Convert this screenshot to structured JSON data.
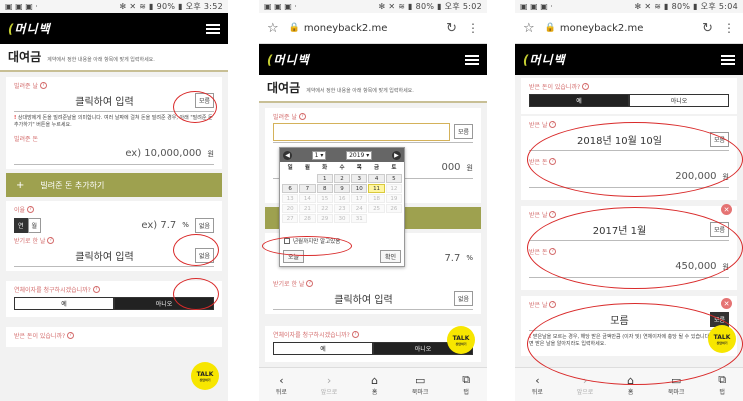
{
  "status": {
    "s1_left": "▣ ▣ ▣ ·",
    "s1_right": "✻ ✕ ≋ ▮ 90% ▮ 오후 3:52",
    "s2_left": "▣ ▣ ▣ ·",
    "s2_right": "✻ ✕ ≋ ▮ 80% ▮ 오후 5:02",
    "s3_left": "▣ ▣ ▣ ·",
    "s3_right": "✻ ✕ ≋ ▮ 80% ▮ 오후 5:04"
  },
  "url": "moneyback2.me",
  "logo": {
    "pre": "(",
    "main": "머니백"
  },
  "title": {
    "main": "대여금",
    "sub": "계약에서 정한 내용을 아래 항목에 맞게 입력하세요."
  },
  "p1": {
    "lend_date_label": "빌려준 날",
    "click_input": "클릭하여 입력",
    "mb": "모름",
    "warn": "상대방에게 돈을 빌려준날을 의미합니다. 여러 날짜에 걸쳐 돈을 빌려준 경우, 아래 \"빌려준 돈 추가하기\" 버튼을 누르세요.",
    "lend_amt_label": "빌려준 돈",
    "amt_ph": "ex) 10,000,000",
    "unit": "원",
    "add_btn": "빌려준 돈 추가하기",
    "add_plus": "+",
    "rate_label": "이율",
    "seg_a": "연",
    "seg_b": "월",
    "rate_ph": "ex) 7.7",
    "pct": "%",
    "mb2": "없음",
    "ret_label": "받기로 한 날",
    "mb3": "없음",
    "claim_q": "연체이자를 청구하시겠습니까?",
    "yes": "예",
    "no": "아니오",
    "recv_q": "받은 돈이 있습니까?"
  },
  "p2": {
    "lend_date_label": "빌려준 날",
    "mb": "모름",
    "amt": "000",
    "unit": "원",
    "month": "1",
    "year": "2019",
    "dow": [
      "일",
      "월",
      "화",
      "수",
      "목",
      "금",
      "토"
    ],
    "days": [
      "",
      "",
      "1",
      "2",
      "3",
      "4",
      "5",
      "6",
      "7",
      "8",
      "9",
      "10",
      "11",
      "12",
      "13",
      "14",
      "15",
      "16",
      "17",
      "18",
      "19",
      "20",
      "21",
      "22",
      "23",
      "24",
      "25",
      "26",
      "27",
      "28",
      "29",
      "30",
      "31",
      "",
      "",
      ""
    ],
    "check": "년월까지만 알고있음",
    "today": "오늘",
    "ok": "확인",
    "rate_ph": "7.7",
    "pct": "%",
    "ret_label": "받기로 한 날",
    "click_input": "클릭하여 입력",
    "mb3": "없음",
    "claim_q": "연체이자를 청구하시겠습니까?",
    "yes": "예",
    "no": "아니오"
  },
  "p3": {
    "recv_q": "받은 돈이 있습니까?",
    "yes": "예",
    "no": "아니오",
    "e1": {
      "date_label": "받은 날",
      "date": "2018년 10월 10일",
      "mb": "모름",
      "amt_label": "받은 돈",
      "amt": "200,000",
      "unit": "원"
    },
    "e2": {
      "date_label": "받은 날",
      "date": "2017년 1월",
      "mb": "모름",
      "amt_label": "받은 돈",
      "amt": "450,000",
      "unit": "원"
    },
    "e3": {
      "date_label": "받은 날",
      "date": "모름",
      "mb": "모름",
      "warn": "받은날을 모르는 경우, 해당 받은 금액만큼 (이자 및) 연체이자에 충당 될 수 있습니다. 가능하면 받은 날을 알아지라도 입력하세요."
    }
  },
  "talk": {
    "main": "TALK",
    "sub": "상담하기"
  },
  "nav": {
    "back": "뒤로",
    "fwd": "앞으로",
    "home": "홈",
    "bm": "북마크",
    "tabs": "탭"
  },
  "close": "✕"
}
